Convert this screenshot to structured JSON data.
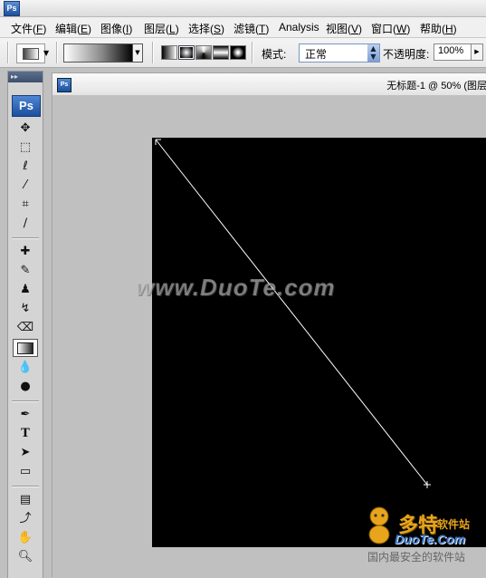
{
  "app": {
    "icon_text": "Ps"
  },
  "menu": [
    {
      "label": "文件(",
      "key": "F",
      "close": ")"
    },
    {
      "label": "编辑(",
      "key": "E",
      "close": ")"
    },
    {
      "label": "图像(",
      "key": "I",
      "close": ")"
    },
    {
      "label": "图层(",
      "key": "L",
      "close": ")"
    },
    {
      "label": "选择(",
      "key": "S",
      "close": ")"
    },
    {
      "label": "滤镜(",
      "key": "T",
      "close": ")"
    },
    {
      "label": "Analysis",
      "key": "",
      "close": ""
    },
    {
      "label": "视图(",
      "key": "V",
      "close": ")"
    },
    {
      "label": "窗口(",
      "key": "W",
      "close": ")"
    },
    {
      "label": "帮助(",
      "key": "H",
      "close": ")"
    }
  ],
  "options": {
    "mode_label": "模式:",
    "mode_value": "正常",
    "opacity_label": "不透明度:",
    "opacity_value": "100%"
  },
  "toolbox": {
    "logo_text": "Ps",
    "grip_text": "▸▸"
  },
  "document": {
    "icon_text": "Ps",
    "title": "无标题-1 @ 50% (图层"
  },
  "watermarks": {
    "main": "www.DuoTe.com",
    "brand": "多特",
    "brand_sub": "软件站",
    "domain": "DuoTe.Com",
    "slogan": "国内最安全的软件站"
  },
  "colors": {
    "canvas": "#000000",
    "workspace": "#c0c0c0",
    "brand": "#e8a51c"
  }
}
